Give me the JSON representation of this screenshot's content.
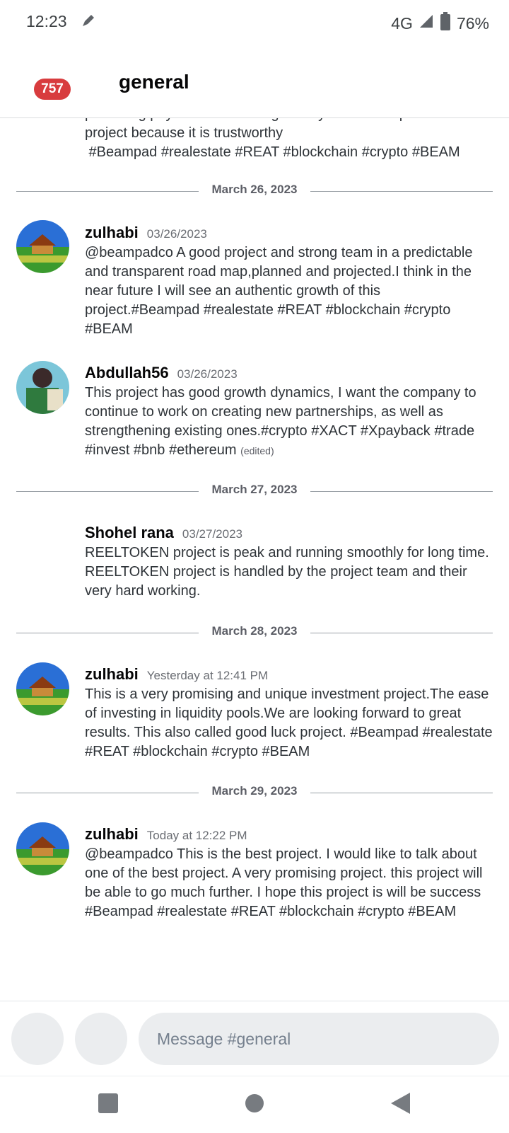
{
  "status_bar": {
    "time": "12:23",
    "network": "4G",
    "battery": "76%",
    "icons": [
      "pen-icon",
      "signal-icon",
      "battery-icon"
    ]
  },
  "header": {
    "badge_count": "757",
    "channel_name": "general"
  },
  "chat": {
    "partial_message": {
      "line1": "promising payment. I encourage everyone to take part in this",
      "line2": "project because it is trustworthy",
      "line3": " #Beampad #realestate #REAT #blockchain #crypto #BEAM"
    },
    "dividers": [
      "March 26, 2023",
      "March 27, 2023",
      "March 28, 2023",
      "March 29, 2023"
    ],
    "messages": [
      {
        "author": "zulhabi",
        "timestamp": "03/26/2023",
        "text": "@beampadco A good project and strong team in a predictable and transparent road map,planned and projected.I think in the near future I will see an authentic growth of this project.#Beampad #realestate #REAT #blockchain #crypto #BEAM"
      },
      {
        "author": "Abdullah56",
        "timestamp": "03/26/2023",
        "text": "This project has good growth dynamics, I want the company to continue to work on creating new partnerships, as well as strengthening existing ones.#crypto #XACT #Xpayback #trade #invest #bnb #ethereum",
        "edited": "(edited)"
      },
      {
        "author": "Shohel rana",
        "timestamp": "03/27/2023",
        "text": "REELTOKEN project is peak and running smoothly for long time. REELTOKEN project is handled by the project team and their very hard working."
      },
      {
        "author": "zulhabi",
        "timestamp": "Yesterday at 12:41 PM",
        "text": "This is a very promising and unique investment project.The ease of investing in liquidity pools.We are looking forward to great results. This also called  good luck project. #Beampad #realestate #REAT #blockchain #crypto #BEAM"
      },
      {
        "author": "zulhabi",
        "timestamp": "Today at 12:22 PM",
        "text": "@beampadco This is the best project. I would like to talk about one of the best project. A very promising project. this project will be able to go much further. I hope this project is will be success #Beampad #realestate #REAT #blockchain #crypto #BEAM"
      }
    ]
  },
  "composer": {
    "placeholder": "Message #general"
  },
  "colors": {
    "badge": "#d83c3e",
    "input_bg": "#ebedef",
    "text": "#2e3338"
  }
}
